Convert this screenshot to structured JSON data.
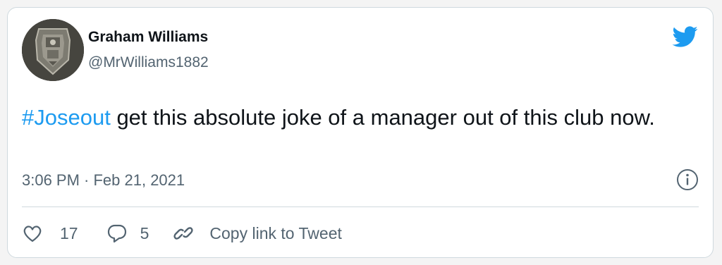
{
  "author": {
    "name": "Graham Williams",
    "handle": "@MrWilliams1882"
  },
  "tweet": {
    "hashtag": "#Joseout",
    "text": " get this absolute joke of a manager out of this club now.",
    "timestamp": "3:06 PM · Feb 21, 2021"
  },
  "actions": {
    "likes": "17",
    "replies": "5",
    "copy_link_label": "Copy link to Tweet"
  },
  "icons": {
    "brand": "twitter-bird-icon",
    "info": "info-icon",
    "like": "heart-icon",
    "reply": "reply-bubble-icon",
    "copy": "link-icon"
  },
  "colors": {
    "accent": "#1d9bf0",
    "text": "#0f1419",
    "muted": "#536471",
    "border": "#cfd9de"
  }
}
